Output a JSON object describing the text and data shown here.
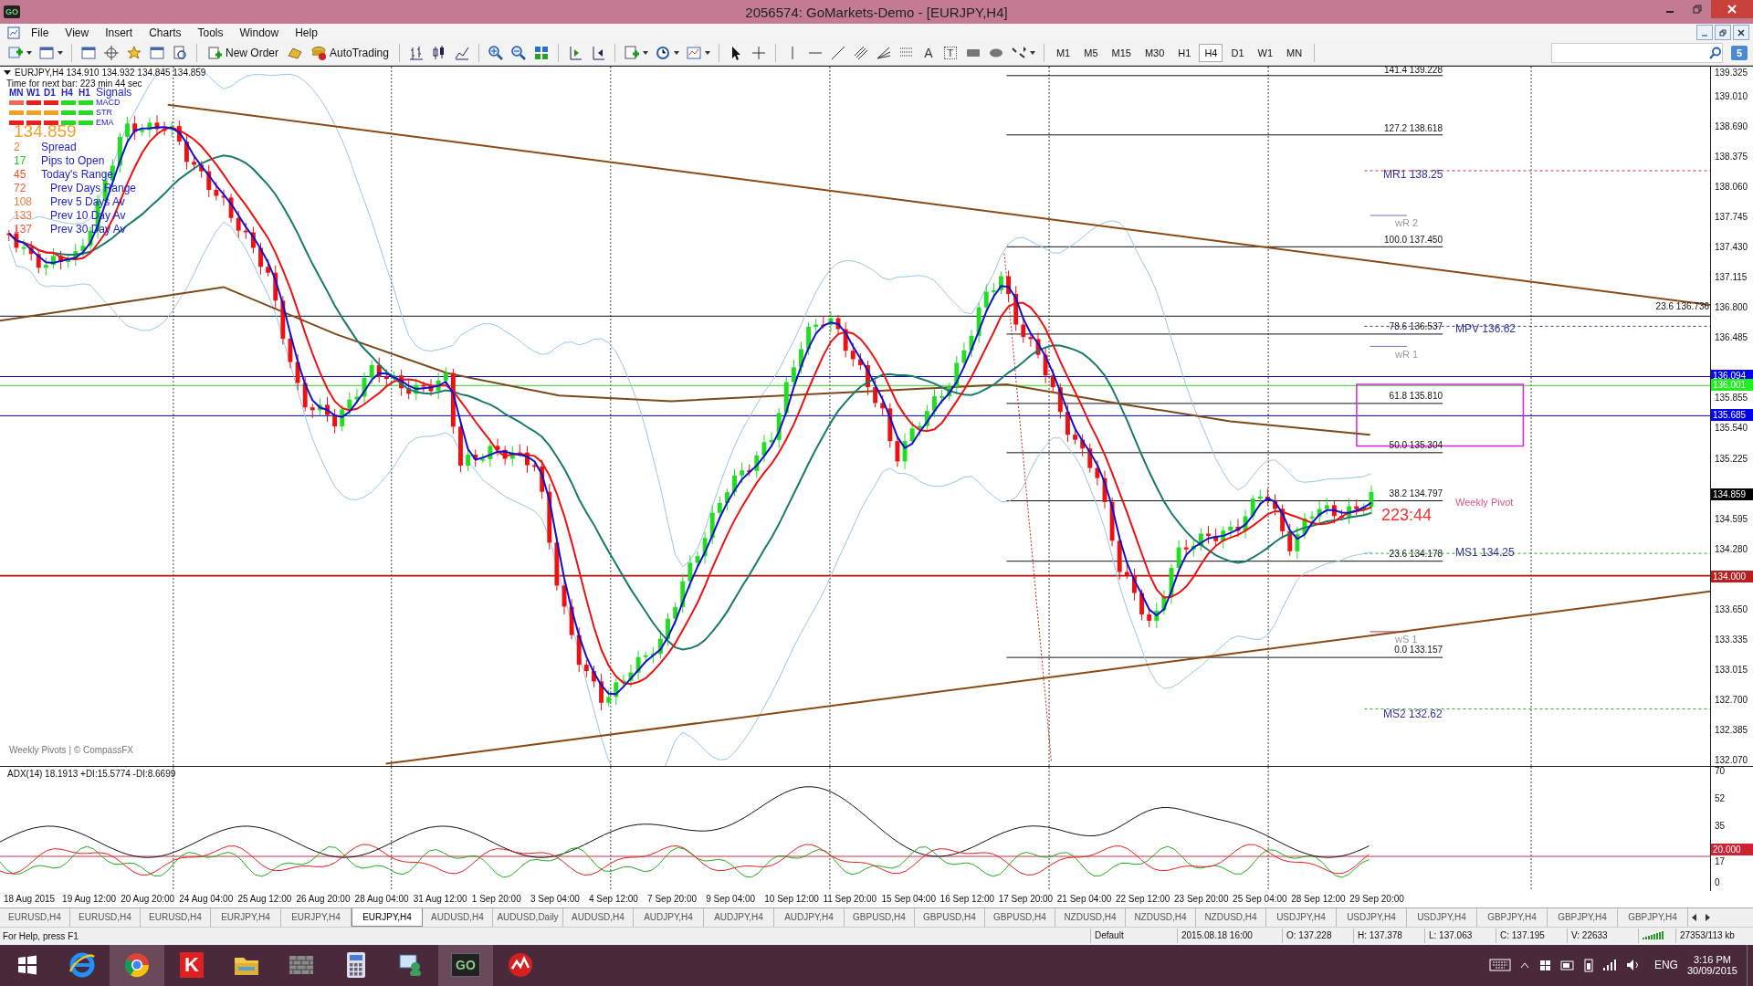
{
  "window": {
    "title": "2056574: GoMarkets-Demo - [EURJPY,H4]",
    "app_badge": "GO"
  },
  "menu": [
    "File",
    "View",
    "Insert",
    "Charts",
    "Tools",
    "Window",
    "Help"
  ],
  "toolbar": {
    "new_order": "New Order",
    "autotrading": "AutoTrading",
    "text_tool": "A",
    "text_label_tool": "T",
    "notifications": "5",
    "timeframes": [
      {
        "label": "M1",
        "selected": false
      },
      {
        "label": "M5",
        "selected": false
      },
      {
        "label": "M15",
        "selected": false
      },
      {
        "label": "M30",
        "selected": false
      },
      {
        "label": "H1",
        "selected": false
      },
      {
        "label": "H4",
        "selected": true
      },
      {
        "label": "D1",
        "selected": false
      },
      {
        "label": "W1",
        "selected": false
      },
      {
        "label": "MN",
        "selected": false
      }
    ]
  },
  "chart": {
    "header": "EURJPY,H4  134.910 134.932 134.845 134.859",
    "next_bar": "Time for next bar: 223 min 44 sec",
    "signals": {
      "columns": [
        "MN",
        "W1",
        "D1",
        "H4",
        "H1"
      ],
      "title": "Signals",
      "rows": [
        {
          "label": "MACD",
          "cells": [
            {
              "color": "#f06a5a"
            },
            {
              "color": "#ee1c1c"
            },
            {
              "color": "#ee1c1c"
            },
            {
              "color": "#22dd22"
            },
            {
              "color": "#22dd22"
            }
          ]
        },
        {
          "label": "STR",
          "cells": [
            {
              "color": "#f5a020"
            },
            {
              "color": "#f5a020"
            },
            {
              "color": "#f5a020"
            },
            {
              "color": "#22dd22"
            },
            {
              "color": "#22dd22"
            }
          ]
        },
        {
          "label": "EMA",
          "cells": [
            {
              "color": "#ee1c1c"
            },
            {
              "color": "#ee1c1c"
            },
            {
              "color": "#ee1c1c"
            },
            {
              "color": "#22dd22"
            },
            {
              "color": "#22dd22"
            }
          ]
        }
      ]
    },
    "price": "134.859",
    "stats": [
      {
        "value": "2",
        "label": "Spread",
        "color": "#f07a20"
      },
      {
        "value": "17",
        "label": "Pips to Open",
        "color": "#22cc22"
      },
      {
        "value": "45",
        "label": "Today's Range",
        "color": "#f05020"
      },
      {
        "value": "72",
        "label": "Prev Days Range",
        "color": "#f05a40"
      },
      {
        "value": "108",
        "label": "Prev 5 Days Av",
        "color": "#f07a40"
      },
      {
        "value": "133",
        "label": "Prev 10 Day Av",
        "color": "#f07a40"
      },
      {
        "value": "137",
        "label": "Prev 30 Day Av",
        "color": "#f05a40"
      }
    ],
    "footer": "Weekly Pivots | © CompassFX",
    "fibonacci_levels": [
      "141.4 139.228",
      "127.2 138.618",
      "100.0 137.450",
      "78.6 136.537",
      "61.8 135.810",
      "50.0 135.304",
      "38.2 134.797",
      "23.6 134.178",
      "0.0 133.157"
    ],
    "fan_level": "23.6  136.736",
    "pivots": [
      {
        "label": "MR1  138.25",
        "kind": "monthly"
      },
      {
        "label": "wR 2",
        "kind": "weekly"
      },
      {
        "label": "MPV  136.62",
        "kind": "monthly"
      },
      {
        "label": "wR 1",
        "kind": "weekly"
      },
      {
        "label": "MS1  134.25",
        "kind": "monthly"
      },
      {
        "label": "wS 1",
        "kind": "weekly"
      },
      {
        "label": "MS2  132.62",
        "kind": "monthly"
      }
    ],
    "countdown": "223:44",
    "weekly_pivot": "Weekly Pivot",
    "price_axis": [
      "139.325",
      "139.010",
      "138.690",
      "138.375",
      "138.060",
      "137.745",
      "137.430",
      "137.115",
      "136.800",
      "136.485",
      "135.855",
      "135.540",
      "135.225",
      "134.595",
      "134.280",
      "133.650",
      "133.335",
      "133.015",
      "132.700",
      "132.385",
      "132.070"
    ],
    "price_badges": [
      {
        "label": "136.094",
        "color": "#0000ee"
      },
      {
        "label": "136.001",
        "color": "#22ee22"
      },
      {
        "label": "135.685",
        "color": "#0000ee"
      },
      {
        "label": "134.859",
        "color": "#000000"
      },
      {
        "label": "134.000",
        "color": "#b22222"
      }
    ],
    "indicator": {
      "header": "ADX(14) 18.1913 +DI:15.5774 -DI:8.6699",
      "axis": [
        "70",
        "52",
        "35",
        "17",
        "0"
      ],
      "badge": "20.000"
    },
    "time_axis": [
      "18 Aug 2015",
      "19 Aug 12:00",
      "20 Aug 20:00",
      "24 Aug 04:00",
      "25 Aug 12:00",
      "26 Aug 20:00",
      "28 Aug 04:00",
      "31 Aug 12:00",
      "1 Sep 20:00",
      "3 Sep 04:00",
      "4 Sep 12:00",
      "7 Sep 20:00",
      "9 Sep 04:00",
      "10 Sep 12:00",
      "11 Sep 20:00",
      "15 Sep 04:00",
      "16 Sep 12:00",
      "17 Sep 20:00",
      "21 Sep 04:00",
      "22 Sep 12:00",
      "23 Sep 20:00",
      "25 Sep 04:00",
      "28 Sep 12:00",
      "29 Sep 20:00"
    ]
  },
  "tabs": [
    {
      "label": "EURUSD,H4",
      "selected": false
    },
    {
      "label": "EURUSD,H4",
      "selected": false
    },
    {
      "label": "EURUSD,H4",
      "selected": false
    },
    {
      "label": "EURJPY,H4",
      "selected": false
    },
    {
      "label": "EURJPY,H4",
      "selected": false
    },
    {
      "label": "EURJPY,H4",
      "selected": true
    },
    {
      "label": "AUDUSD,H4",
      "selected": false
    },
    {
      "label": "AUDUSD,Daily",
      "selected": false
    },
    {
      "label": "AUDUSD,H4",
      "selected": false
    },
    {
      "label": "AUDJPY,H4",
      "selected": false
    },
    {
      "label": "AUDJPY,H4",
      "selected": false
    },
    {
      "label": "AUDJPY,H4",
      "selected": false
    },
    {
      "label": "GBPUSD,H4",
      "selected": false
    },
    {
      "label": "GBPUSD,H4",
      "selected": false
    },
    {
      "label": "GBPUSD,H4",
      "selected": false
    },
    {
      "label": "NZDUSD,H4",
      "selected": false
    },
    {
      "label": "NZDUSD,H4",
      "selected": false
    },
    {
      "label": "NZDUSD,H4",
      "selected": false
    },
    {
      "label": "USDJPY,H4",
      "selected": false
    },
    {
      "label": "USDJPY,H4",
      "selected": false
    },
    {
      "label": "USDJPY,H4",
      "selected": false
    },
    {
      "label": "GBPJPY,H4",
      "selected": false
    },
    {
      "label": "GBPJPY,H4",
      "selected": false
    },
    {
      "label": "GBPJPY,H4",
      "selected": false
    }
  ],
  "status_bar": {
    "help": "For Help, press F1",
    "profile": "Default",
    "time": "2015.08.18 16:00",
    "open": "O: 137.228",
    "high": "H: 137.378",
    "low": "L: 137.063",
    "close": "C: 137.195",
    "volume": "V: 22633",
    "traffic": "27353/113 kb"
  },
  "taskbar": {
    "k_app": "K",
    "go_app": "GO",
    "language": "ENG",
    "clock": "3:16 PM",
    "date": "30/09/2015"
  }
}
